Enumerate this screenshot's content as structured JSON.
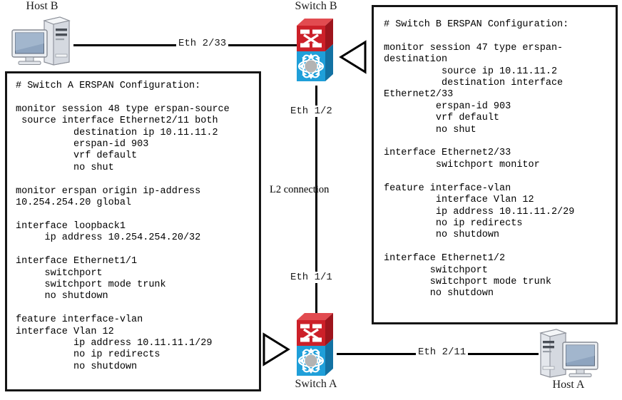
{
  "diagram": {
    "title": "ERSPAN configuration topology between Switch A and Switch B",
    "colors": {
      "switch_top_red": "#cc2029",
      "switch_bottom_blue": "#1f9fd9",
      "switch_hub_gray": "#b3b3b3",
      "line_black": "#000000",
      "box_border": "#151515",
      "host_body": "#e8eaee",
      "host_screen": "#8ea4bf"
    }
  },
  "devices": {
    "host_b": {
      "label": "Host B",
      "icon": "desktop-computer-icon"
    },
    "host_a": {
      "label": "Host A",
      "icon": "desktop-computer-icon"
    },
    "switch_b": {
      "label": "Switch B",
      "icon": "multilayer-switch-icon"
    },
    "switch_a": {
      "label": "Switch A",
      "icon": "multilayer-switch-icon"
    }
  },
  "links": [
    {
      "id": "hostb-switchb",
      "label": "Eth 2/33",
      "orientation": "horizontal"
    },
    {
      "id": "switchb-down",
      "label": "Eth 1/2",
      "orientation": "vertical"
    },
    {
      "id": "switcha-up",
      "label": "Eth 1/1",
      "orientation": "vertical"
    },
    {
      "id": "switcha-hosta",
      "label": "Eth 2/11",
      "orientation": "horizontal"
    },
    {
      "id": "l2-trunk",
      "label": "L2 connection",
      "orientation": "vertical"
    }
  ],
  "config_a": {
    "heading": "# Switch A ERSPAN Configuration:",
    "text": "# Switch A ERSPAN Configuration:\n\nmonitor session 48 type erspan-source\n source interface Ethernet2/11 both\n          destination ip 10.11.11.2\n          erspan-id 903\n          vrf default\n          no shut\n\nmonitor erspan origin ip-address\n10.254.254.20 global\n\ninterface loopback1\n     ip address 10.254.254.20/32\n\ninterface Ethernet1/1\n     switchport\n     switchport mode trunk\n     no shutdown\n\nfeature interface-vlan\ninterface Vlan 12\n          ip address 10.11.11.1/29\n          no ip redirects\n          no shutdown"
  },
  "config_b": {
    "heading": "# Switch B ERSPAN Configuration:",
    "text": "# Switch B ERSPAN Configuration:\n\nmonitor session 47 type erspan-\ndestination\n          source ip 10.11.11.2\n          destination interface\nEthernet2/33\n         erspan-id 903\n         vrf default\n         no shut\n\ninterface Ethernet2/33\n         switchport monitor\n\nfeature interface-vlan\n         interface Vlan 12\n         ip address 10.11.11.2/29\n         no ip redirects\n         no shutdown\n\ninterface Ethernet1/2\n        switchport\n        switchport mode trunk\n        no shutdown"
  },
  "pointers": [
    {
      "id": "pointer-to-config-b",
      "direction": "left",
      "name": "callout-arrow-left"
    },
    {
      "id": "pointer-to-config-a",
      "direction": "right",
      "name": "callout-arrow-right"
    }
  ]
}
